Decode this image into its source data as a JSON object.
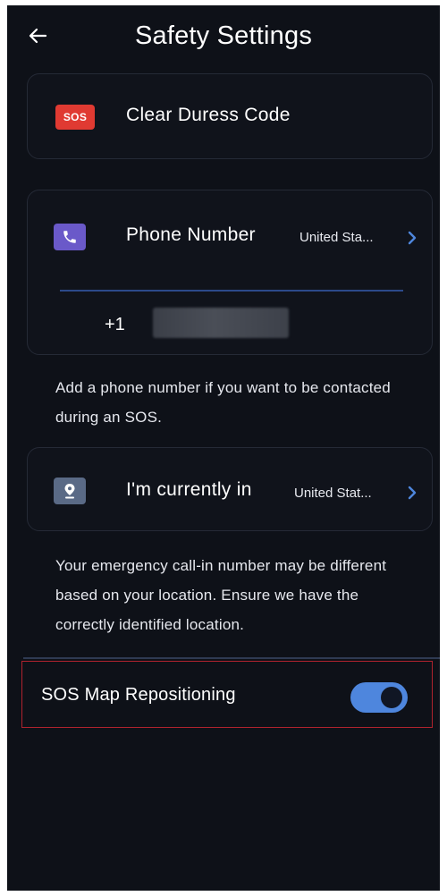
{
  "header": {
    "title": "Safety Settings",
    "back_icon": "arrow-left-icon"
  },
  "duress": {
    "badge": "SOS",
    "label": "Clear Duress Code"
  },
  "phone": {
    "icon": "phone-icon",
    "label": "Phone Number",
    "country": "United Sta...",
    "dial_code": "+1",
    "helper": "Add a phone number if you want to be contacted during an SOS."
  },
  "location": {
    "icon": "location-pin-icon",
    "label": "I'm currently in",
    "country": "United Stat...",
    "helper": "Your emergency call-in number may be different based on your location. Ensure we have the correctly identified location."
  },
  "map_repositioning": {
    "label": "SOS Map Repositioning",
    "enabled": true
  },
  "colors": {
    "background": "#0e1118",
    "sos_red": "#e03a32",
    "phone_purple": "#6a59c9",
    "location_slate": "#5a6a86",
    "accent_blue": "#4e86dd",
    "highlight_red": "#b0232e"
  }
}
